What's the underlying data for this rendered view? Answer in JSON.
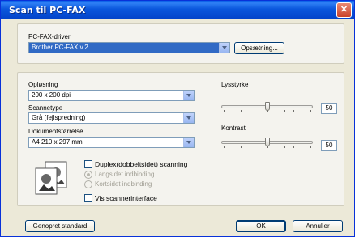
{
  "window": {
    "title": "Scan til PC-FAX",
    "close_glyph": "✕"
  },
  "fax_driver": {
    "label": "PC-FAX-driver",
    "value": "Brother PC-FAX v.2",
    "setup_button": "Opsætning..."
  },
  "resolution": {
    "label": "Opløsning",
    "value": "200 x 200 dpi"
  },
  "scan_type": {
    "label": "Scannetype",
    "value": "Grå (fejlspredning)"
  },
  "doc_size": {
    "label": "Dokumentstørrelse",
    "value": "A4 210 x 297 mm"
  },
  "brightness": {
    "label": "Lysstyrke",
    "value": "50",
    "level_percent": 50
  },
  "contrast": {
    "label": "Kontrast",
    "value": "50",
    "level_percent": 50
  },
  "duplex": {
    "label": "Duplex(dobbeltsidet) scanning",
    "checked": false,
    "options": [
      "Langsidet indbinding",
      "Kortsidet indbinding"
    ],
    "selected_option": "Langsidet indbinding"
  },
  "show_scanner_ui": {
    "label": "Vis scannerinterface",
    "checked": false
  },
  "buttons": {
    "restore": "Genopret standard",
    "ok": "OK",
    "cancel": "Annuller"
  },
  "icons": {
    "close": "close-icon",
    "dropdown": "chevron-down-icon",
    "duplex": "duplex-pages-icon"
  }
}
